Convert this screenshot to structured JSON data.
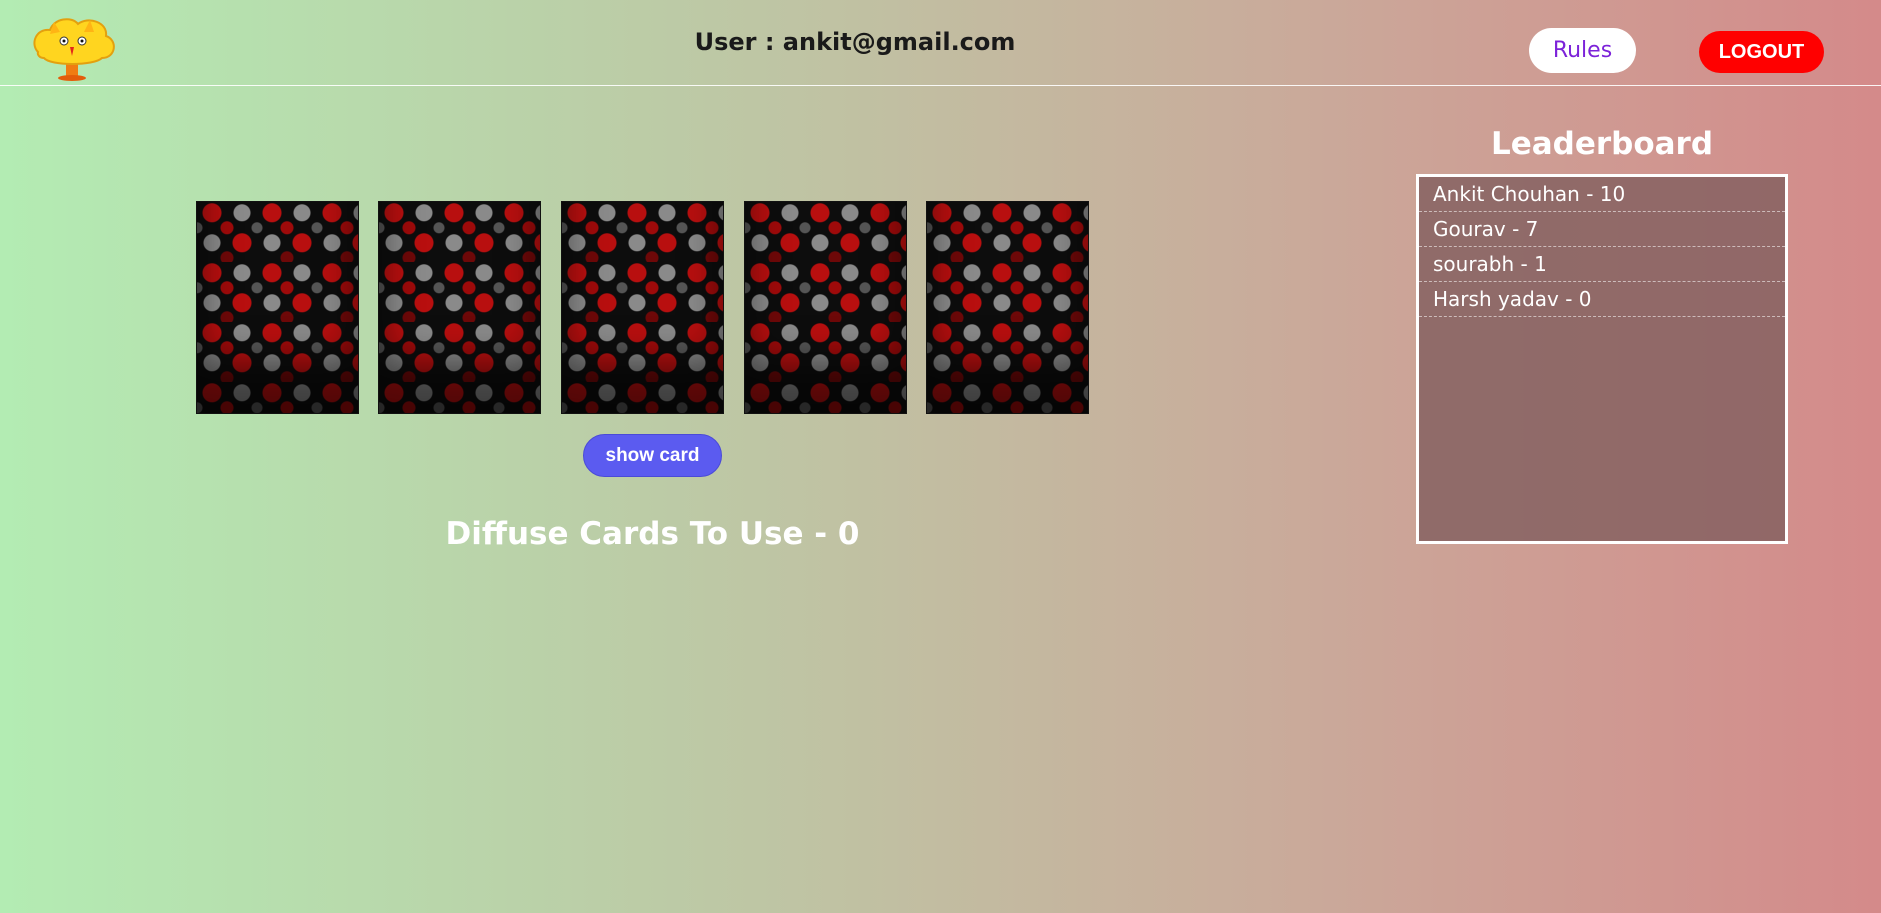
{
  "header": {
    "user_label": "User : ankit@gmail.com",
    "rules_label": "Rules",
    "logout_label": "LOGOUT"
  },
  "game": {
    "card_count": 5,
    "show_card_label": "show card",
    "diffuse_text": "Diffuse Cards To Use - 0"
  },
  "leaderboard": {
    "title": "Leaderboard",
    "entries": [
      "Ankit Chouhan - 10",
      "Gourav - 7",
      "sourabh - 1",
      "Harsh yadav - 0"
    ]
  },
  "colors": {
    "gradient_start": "#b3ecb3",
    "gradient_end": "#d48a8a",
    "rules_text": "#7c22d9",
    "logout_bg": "#ff0000",
    "show_card_bg": "#5b5bf0"
  }
}
